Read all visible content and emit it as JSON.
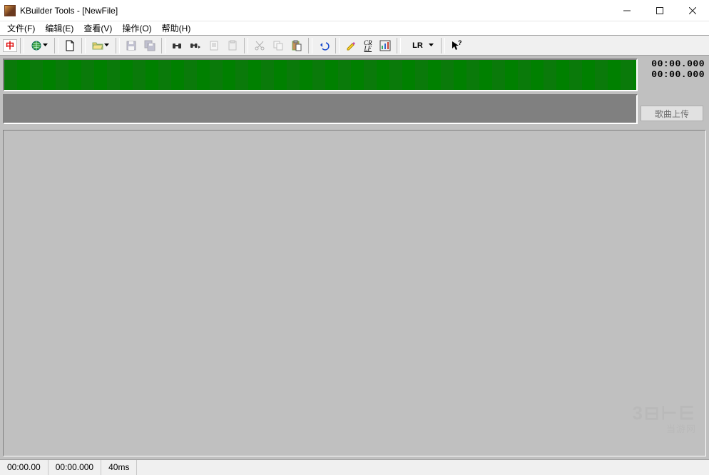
{
  "window": {
    "title": "KBuilder Tools - [NewFile]"
  },
  "menu": {
    "file": "文件(F)",
    "edit": "编辑(E)",
    "view": "查看(V)",
    "operate": "操作(O)",
    "help": "帮助(H)"
  },
  "toolbar": {
    "lang": "中",
    "lr": "LR",
    "crlf_top": "CR",
    "crlf_bot": "LF"
  },
  "timer": {
    "top": "00:00.000",
    "bottom": "00:00.000"
  },
  "side": {
    "upload": "歌曲上传"
  },
  "status": {
    "time1": "00:00.00",
    "time2": "00:00.000",
    "step": "40ms"
  },
  "watermark": {
    "big": "3⊟⊢⋿",
    "small": "当游网"
  }
}
